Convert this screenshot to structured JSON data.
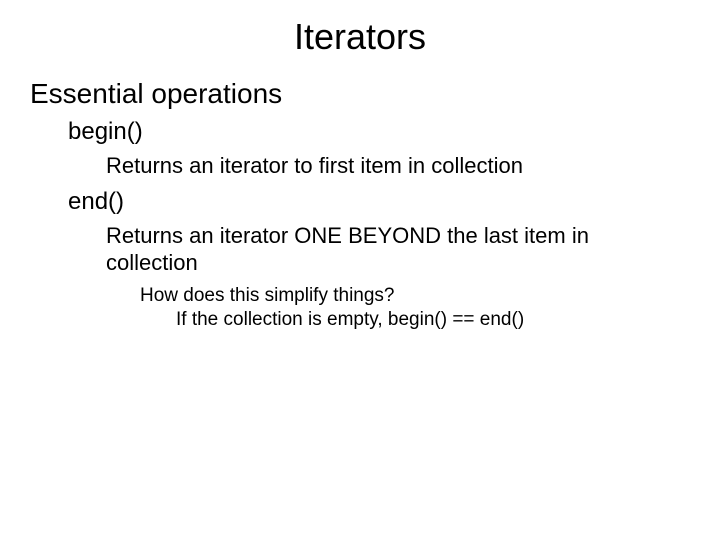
{
  "title": "Iterators",
  "section": "Essential operations",
  "ops": [
    {
      "name": "begin()",
      "desc": "Returns an iterator to first item in collection"
    },
    {
      "name": "end()",
      "desc": "Returns an iterator ONE BEYOND the last item in collection"
    }
  ],
  "notes": {
    "q": "How does this simplify things?",
    "a": "If the collection is empty, begin() == end()"
  }
}
